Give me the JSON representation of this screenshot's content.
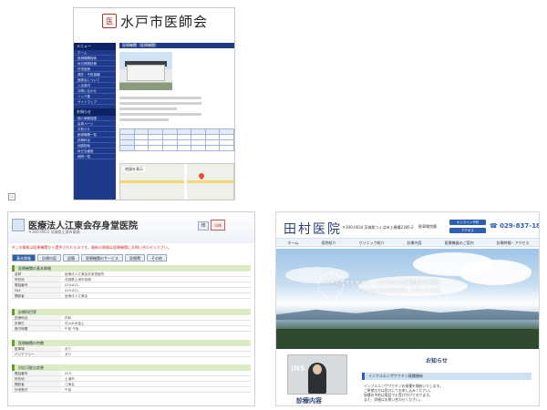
{
  "mito": {
    "logo_text": "水戸市医師会",
    "nav_header": "メニュー",
    "nav_items": [
      "ホーム",
      "医療機関検索",
      "休日夜間診療",
      "在宅医療",
      "健診・予防接種",
      "医師会について",
      "入会案内",
      "お問い合わせ",
      "リンク集",
      "サイトマップ",
      "個人情報保護",
      "会員ページ",
      "お知らせ",
      "医療機関一覧",
      "診療科目",
      "地図検索",
      "休日当番医",
      "病院一覧"
    ],
    "nav_header2": "お知らせ",
    "main_header": "医療機関（医療機関）",
    "map_label": "地図を表示"
  },
  "kodokai": {
    "title": "医療法人江東会存身堂医院",
    "address": "〒300-0051 茨城県土浦市真鍋",
    "note": "※この情報は医療機関から提供されたものです。最新の情報は医療機関にお問い合わせください。",
    "print": "印",
    "badge": "印刷",
    "tabs": [
      "基本情報",
      "診療内容",
      "設備",
      "医療機関のサービス",
      "医療費",
      "その他"
    ],
    "sections": [
      {
        "title": "医療機関の基本情報",
        "rows": [
          [
            "名称",
            "医療法人江東会存身堂医院"
          ],
          [
            "所在地",
            "茨城県土浦市真鍋"
          ],
          [
            "電話番号",
            "029-821-"
          ],
          [
            "FAX",
            "029-821-"
          ],
          [
            "開設者",
            "医療法人江東会"
          ]
        ]
      },
      {
        "title": "診療科目等",
        "rows": [
          [
            "診療科目",
            "内科"
          ],
          [
            "診療日",
            "月火水木金土"
          ],
          [
            "受付時間",
            "午前 午後"
          ]
        ]
      },
      {
        "title": "医療機関の特徴",
        "rows": [
          [
            "駐車場",
            "あり"
          ],
          [
            "バリアフリー",
            "あり"
          ]
        ]
      },
      {
        "title": "対応可能な疾患",
        "rows": [
          [
            "電話番号",
            "029-"
          ],
          [
            "所在地",
            "土浦市"
          ],
          [
            "開設者",
            "江東会"
          ],
          [
            "外来受付",
            "午前"
          ]
        ]
      }
    ]
  },
  "tamura": {
    "logo": "田村医院",
    "address": "〒300-0034 茨城県つくば市上横場2395-2",
    "parking": "駐車場完備",
    "btn_web": "オンライン予約",
    "btn_map": "アクセス",
    "tel": "029-837-1800",
    "nav": [
      "ホーム",
      "医院紹介",
      "クリニック紹介",
      "診療内容",
      "医療機器のご案内",
      "診療時間・アクセス"
    ],
    "catch_line1": "90年の歴史を継承し、これからも地域医療の発展を",
    "catch_line2": "皆さまに医療を提供してまいります。",
    "doc_watermark": "INS",
    "doctor_heading": "診療内容",
    "news_heading": "お知らせ",
    "news_bar": "インフルエンザワクチン接種開始",
    "news_lines": [
      "インフルエンザワクチンの接種を開始いたします。",
      "ご希望の方は窓口にてお申し込みください。",
      "接種の予約は電話でも受け付けております。",
      "また、詳細はお問い合わせください。"
    ]
  }
}
